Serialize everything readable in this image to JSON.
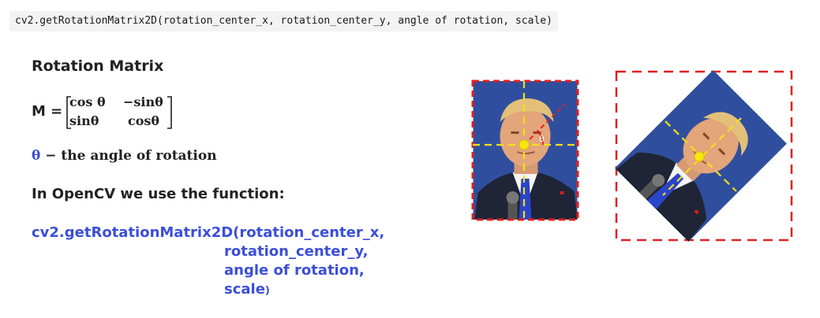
{
  "code_line": "cv2.getRotationMatrix2D(rotation_center_x, rotation_center_y, angle of rotation, scale)",
  "section_title": "Rotation Matrix",
  "matrix": {
    "label": "M =",
    "r1c1": "cos θ",
    "r1c2": "−sinθ",
    "r2c1": "sinθ",
    "r2c2": "cosθ"
  },
  "theta_line": {
    "symbol": "θ",
    "text": " − the angle of rotation"
  },
  "use_line": "In OpenCV we use the function:",
  "function_call": {
    "line1": "cv2.getRotationMatrix2D(rotation_center_x,",
    "line2": "rotation_center_y,",
    "line3": "angle of rotation,",
    "line4": "scale",
    "close": ")"
  },
  "figure": {
    "angle_label": "θ",
    "colors": {
      "frame": "#e02020",
      "guides": "#f2e01a",
      "photo_background": "#2f4f9e",
      "angle_line": "#e02020"
    },
    "icons": [
      "portrait-photo",
      "rotated-portrait-photo",
      "center-point"
    ]
  }
}
